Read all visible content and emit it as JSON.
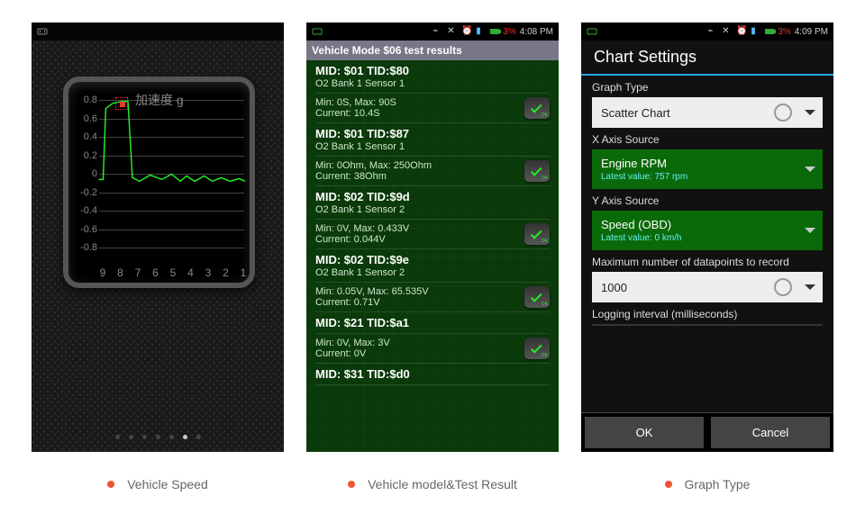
{
  "captions": {
    "s1": "Vehicle Speed",
    "s2": "Vehicle model&Test Result",
    "s3": "Graph Type"
  },
  "screen1": {
    "statusbar": {
      "nfc": ""
    },
    "chart_title": "加速度 g",
    "y_labels": [
      "0.8",
      "0.6",
      "0.4",
      "0.2",
      "0",
      "-0.2",
      "-0.4",
      "-0.6",
      "-0.8"
    ],
    "x_labels": [
      "9",
      "8",
      "7",
      "6",
      "5",
      "4",
      "3",
      "2",
      "1"
    ],
    "page_dots": 7,
    "active_dot": 5
  },
  "chart_data": {
    "type": "line",
    "title": "加速度 g",
    "xlabel": "",
    "ylabel": "",
    "xlim": [
      0,
      10
    ],
    "ylim": [
      -0.9,
      0.9
    ],
    "x": [
      9.5,
      9.3,
      9.1,
      8.9,
      8.7,
      8.4,
      8.2,
      8.0,
      7.5,
      7.0,
      6.5,
      6.0,
      5.5,
      5.0,
      4.5,
      4.0,
      3.5,
      3.0,
      2.5,
      2.0,
      1.5,
      1.0,
      0.5
    ],
    "y": [
      0.0,
      0.0,
      0.8,
      0.85,
      0.9,
      0.9,
      0.1,
      0.0,
      0.1,
      0.05,
      0.1,
      0.02,
      0.08,
      0.0,
      0.1,
      0.03,
      0.08,
      0.02,
      0.06,
      0.02,
      0.05,
      0.01,
      0.03
    ],
    "marker": {
      "x": 8.7,
      "y": 0.9
    }
  },
  "screen2": {
    "statusbar": {
      "batt_pct": "3%",
      "time": "4:08 PM"
    },
    "titlebar": "Vehicle Mode $06 test results",
    "rows": [
      {
        "mid": "MID: $01 TID:$80",
        "sub": "O2 Bank 1 Sensor 1",
        "l1": "Min: 0S, Max: 90S",
        "l2": "Current: 10.4S"
      },
      {
        "mid": "MID: $01 TID:$87",
        "sub": "O2 Bank 1 Sensor 1",
        "l1": "Min: 0Ohm, Max: 250Ohm",
        "l2": "Current: 38Ohm"
      },
      {
        "mid": "MID: $02 TID:$9d",
        "sub": "O2 Bank 1 Sensor 2",
        "l1": "Min: 0V, Max: 0.433V",
        "l2": "Current: 0.044V"
      },
      {
        "mid": "MID: $02 TID:$9e",
        "sub": "O2 Bank 1 Sensor 2",
        "l1": "Min: 0.05V, Max: 65.535V",
        "l2": "Current: 0.71V"
      },
      {
        "mid": "MID: $21 TID:$a1",
        "sub": "",
        "l1": "Min: 0V, Max: 3V",
        "l2": "Current: 0V"
      },
      {
        "mid": "MID: $31 TID:$d0",
        "sub": "",
        "l1": "",
        "l2": ""
      }
    ],
    "ok_label": "OK"
  },
  "screen3": {
    "statusbar": {
      "batt_pct": "3%",
      "time": "4:09 PM"
    },
    "title": "Chart Settings",
    "graph_type_label": "Graph Type",
    "graph_type_value": "Scatter Chart",
    "x_label": "X Axis Source",
    "x_value": "Engine RPM",
    "x_latest": "Latest value: 757 rpm",
    "y_label": "Y Axis Source",
    "y_value": "Speed (OBD)",
    "y_latest": "Latest value: 0 km/h",
    "max_dp_label": "Maximum number of datapoints to record",
    "max_dp_value": "1000",
    "log_int_label": "Logging interval (milliseconds)",
    "ok": "OK",
    "cancel": "Cancel"
  }
}
